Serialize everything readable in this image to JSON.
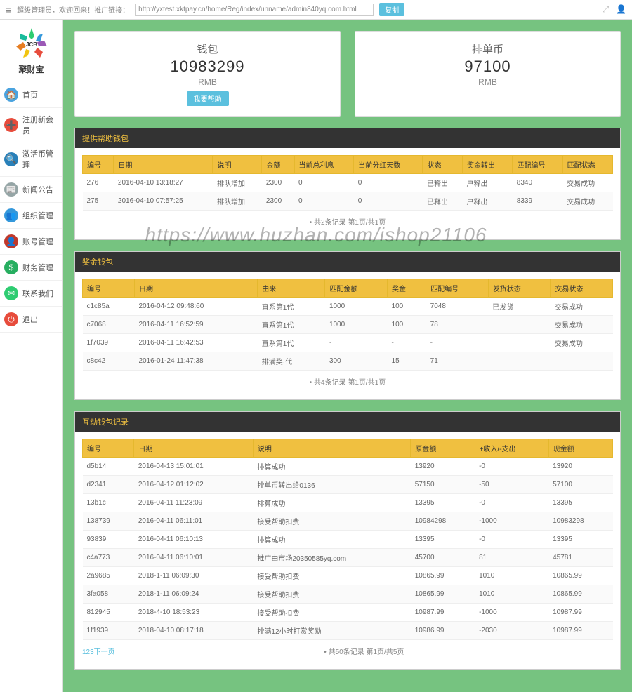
{
  "brand": "聚财宝",
  "top": {
    "greeting": "超级管理员，欢迎回来！推广链接：",
    "url": "http://yxtest.xktpay.cn/home/Reg/index/unname/admin840yq.com.html",
    "search_btn": "复制"
  },
  "sidebar": [
    {
      "label": "首页",
      "color": "#4aa3df",
      "glyph": "🏠"
    },
    {
      "label": "注册新会员",
      "color": "#e74c3c",
      "glyph": "➕"
    },
    {
      "label": "激活币管理",
      "color": "#2980b9",
      "glyph": "🔍"
    },
    {
      "label": "新闻公告",
      "color": "#95a5a6",
      "glyph": "📰"
    },
    {
      "label": "组织管理",
      "color": "#3498db",
      "glyph": "👥"
    },
    {
      "label": "账号管理",
      "color": "#c0392b",
      "glyph": "👤"
    },
    {
      "label": "财务管理",
      "color": "#27ae60",
      "glyph": "$"
    },
    {
      "label": "联系我们",
      "color": "#2ecc71",
      "glyph": "✉"
    },
    {
      "label": "退出",
      "color": "#e74c3c",
      "glyph": "⏻"
    }
  ],
  "cards": {
    "wallet": {
      "title": "钱包",
      "value": "10983299",
      "unit": "RMB",
      "btn": "我要帮助"
    },
    "paidan": {
      "title": "排单币",
      "value": "97100",
      "unit": "RMB"
    }
  },
  "panel1": {
    "title": "提供帮助钱包",
    "headers": [
      "编号",
      "日期",
      "说明",
      "金额",
      "当前总利息",
      "当前分红天数",
      "状态",
      "奖金转出",
      "匹配编号",
      "匹配状态"
    ],
    "rows": [
      [
        "276",
        "2016-04-10 13:18:27",
        "排队增加",
        "2300",
        "0",
        "0",
        "已释出",
        "户释出",
        "8340",
        "交易成功"
      ],
      [
        "275",
        "2016-04-10 07:57:25",
        "排队增加",
        "2300",
        "0",
        "0",
        "已释出",
        "户释出",
        "8339",
        "交易成功"
      ]
    ],
    "pager": "共2条记录 第1页/共1页"
  },
  "panel2": {
    "title": "奖金钱包",
    "headers": [
      "编号",
      "日期",
      "由来",
      "匹配金额",
      "奖金",
      "匹配编号",
      "发货状态",
      "交易状态"
    ],
    "rows": [
      [
        "c1c85a",
        "2016-04-12 09:48:60",
        "直系第1代",
        "1000",
        "100",
        "7048",
        "已发货",
        "交易成功"
      ],
      [
        "c7068",
        "2016-04-11 16:52:59",
        "直系第1代",
        "1000",
        "100",
        "78",
        "",
        "交易成功"
      ],
      [
        "1f7039",
        "2016-04-11 16:42:53",
        "直系第1代",
        "-",
        "-",
        "-",
        "",
        "交易成功"
      ],
      [
        "c8c42",
        "2016-01-24 11:47:38",
        "排满奖·代",
        "300",
        "15",
        "71",
        "",
        ""
      ]
    ],
    "pager": "共4条记录 第1页/共1页"
  },
  "panel3": {
    "title": "互动钱包记录",
    "headers": [
      "编号",
      "日期",
      "说明",
      "原金额",
      "+收入/-支出",
      "现金额"
    ],
    "rows": [
      [
        "d5b14",
        "2016-04-13 15:01:01",
        "排算成功",
        "13920",
        "-0",
        "13920"
      ],
      [
        "d2341",
        "2016-04-12 01:12:02",
        "排单币转出给0136",
        "57150",
        "-50",
        "57100"
      ],
      [
        "13b1c",
        "2016-04-11 11:23:09",
        "排算成功",
        "13395",
        "-0",
        "13395"
      ],
      [
        "138739",
        "2016-04-11 06:11:01",
        "接受帮助扣费",
        "10984298",
        "-1000",
        "10983298"
      ],
      [
        "93839",
        "2016-04-11 06:10:13",
        "排算成功",
        "13395",
        "-0",
        "13395"
      ],
      [
        "c4a773",
        "2016-04-11 06:10:01",
        "推广由市场20350585yq.com",
        "45700",
        "81",
        "45781"
      ],
      [
        "2a9685",
        "2018-1-11 06:09:30",
        "接受帮助扣费",
        "10865.99",
        "1010",
        "10865.99"
      ],
      [
        "3fa058",
        "2018-1-11 06:09:24",
        "接受帮助扣费",
        "10865.99",
        "1010",
        "10865.99"
      ],
      [
        "812945",
        "2018-4-10 18:53:23",
        "接受帮助扣费",
        "10987.99",
        "-1000",
        "10987.99"
      ],
      [
        "1f1939",
        "2018-04-10 08:17:18",
        "排满12小时打赏奖励",
        "10986.99",
        "-2030",
        "10987.99"
      ]
    ],
    "pager_links": "123下一页",
    "pager": "共50条记录 第1页/共5页"
  },
  "watermark": "https://www.huzhan.com/ishop21106"
}
